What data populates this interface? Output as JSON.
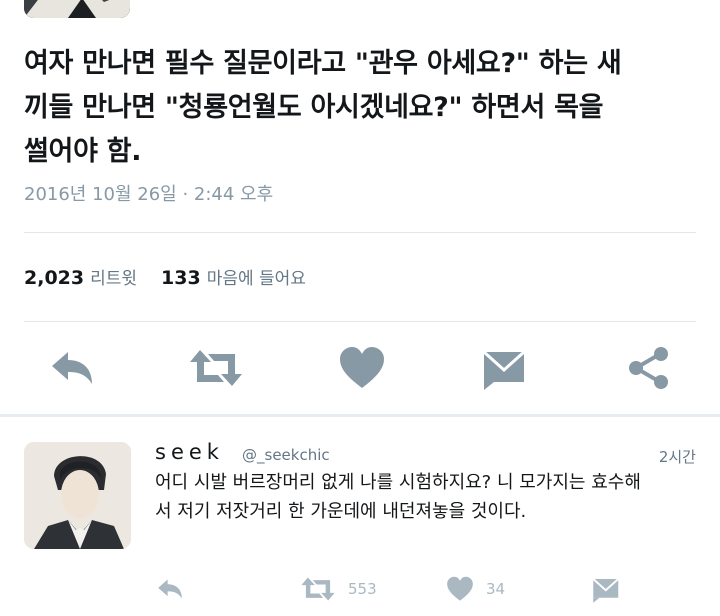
{
  "tweet": {
    "text_lines": [
      "여자 만나면 필수 질문이라고 \"관우 아세요?\" 하는 새",
      "끼들 만나면 \"청룡언월도 아시겠네요?\" 하면서 목을",
      "썰어야 함."
    ],
    "timestamp": "2016년 10월 26일 · 2:44 오후",
    "retweet_count": "2,023",
    "retweet_label": "리트윗",
    "like_count": "133",
    "like_label": "마음에 들어요"
  },
  "actions": {
    "icons": [
      "reply-icon",
      "retweet-icon",
      "heart-icon",
      "message-icon",
      "share-icon"
    ],
    "color": "#8899a6"
  },
  "reply": {
    "name": "seek",
    "handle": "@_seekchic",
    "time": "2시간",
    "text_lines": [
      "어디 시발 버르장머리 없게 나를 시험하지요? 니 모가지는 효수해",
      "서 저기 저잣거리 한 가운데에 내던져놓을 것이다."
    ],
    "retweet_count": "553",
    "like_count": "34",
    "icon_color": "#aab8c2"
  }
}
